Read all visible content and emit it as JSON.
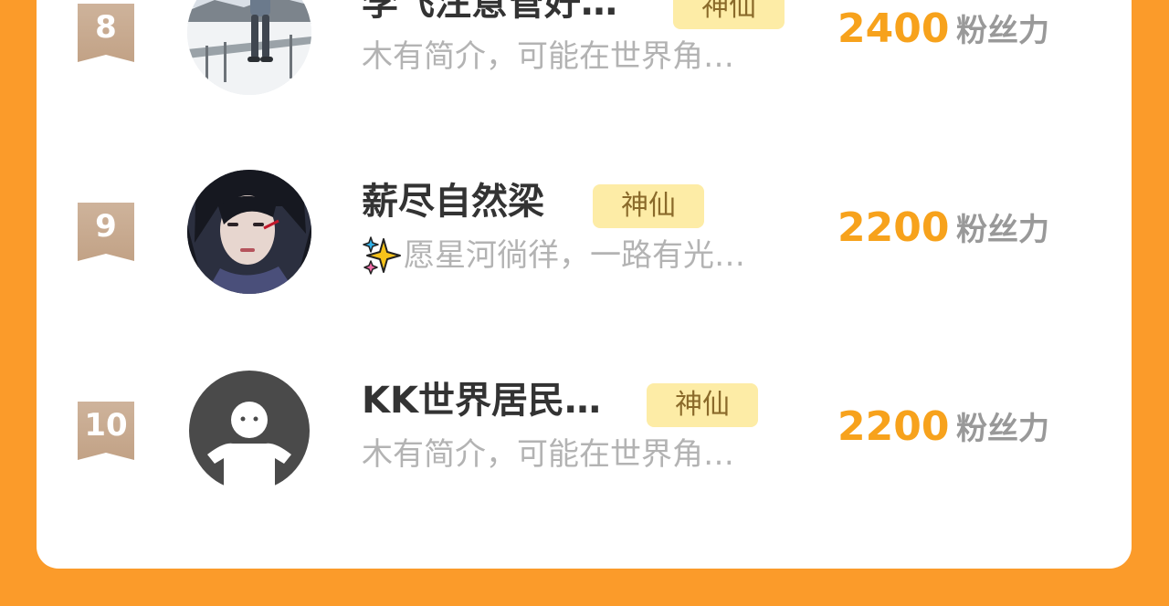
{
  "colors": {
    "page_background": "#fb9b2a",
    "card_background": "#ffffff",
    "score": "#f7a21c",
    "tag_background": "#fdeca6",
    "tag_text": "#8a6a2a",
    "rank_badge": "#c9ab92",
    "name": "#333333",
    "bio": "#b3b3b3",
    "unit": "#999999"
  },
  "leaderboard": {
    "entries": [
      {
        "rank": "8",
        "name": "李飞注意管好…",
        "tag": "神仙",
        "bio": "木有简介，可能在世界角…",
        "score": "2400",
        "unit": "粉丝力",
        "avatar": "photo-person-snowy-landscape",
        "bio_icon": ""
      },
      {
        "rank": "9",
        "name": "薪尽自然梁",
        "tag": "神仙",
        "bio": "愿星河徜徉，一路有光…",
        "score": "2200",
        "unit": "粉丝力",
        "avatar": "photo-dark-haired-character",
        "bio_icon": "sparkles-icon"
      },
      {
        "rank": "10",
        "name": "KK世界居民…",
        "tag": "神仙",
        "bio": "木有简介，可能在世界角…",
        "score": "2200",
        "unit": "粉丝力",
        "avatar": "default-avatar-icon",
        "bio_icon": ""
      }
    ]
  }
}
